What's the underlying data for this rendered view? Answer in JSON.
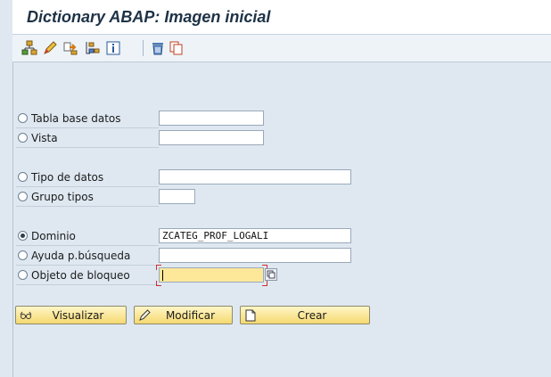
{
  "window": {
    "title": "Dictionary ABAP: Imagen inicial"
  },
  "toolbar": {
    "icons": [
      "hierarchy-icon",
      "pencil-icon",
      "where-used-icon",
      "object-list-icon",
      "info-icon",
      "trash-icon",
      "copy-icon"
    ]
  },
  "options": [
    {
      "label": "Tabla base datos",
      "value": "",
      "selected": false
    },
    {
      "label": "Vista",
      "value": "",
      "selected": false
    },
    {
      "label": "Tipo de datos",
      "value": "",
      "selected": false
    },
    {
      "label": "Grupo tipos",
      "value": "",
      "selected": false
    },
    {
      "label": "Dominio",
      "value": "ZCATEG_PROF_LOGALI",
      "selected": true
    },
    {
      "label": "Ayuda p.búsqueda",
      "value": "",
      "selected": false
    },
    {
      "label": "Objeto de bloqueo",
      "value": "",
      "selected": false
    }
  ],
  "buttons": {
    "display": "Visualizar",
    "change": "Modificar",
    "create": "Crear"
  },
  "colors": {
    "background": "#dfe8f1",
    "active_field": "#fde89a",
    "button": "#f5d96f"
  }
}
